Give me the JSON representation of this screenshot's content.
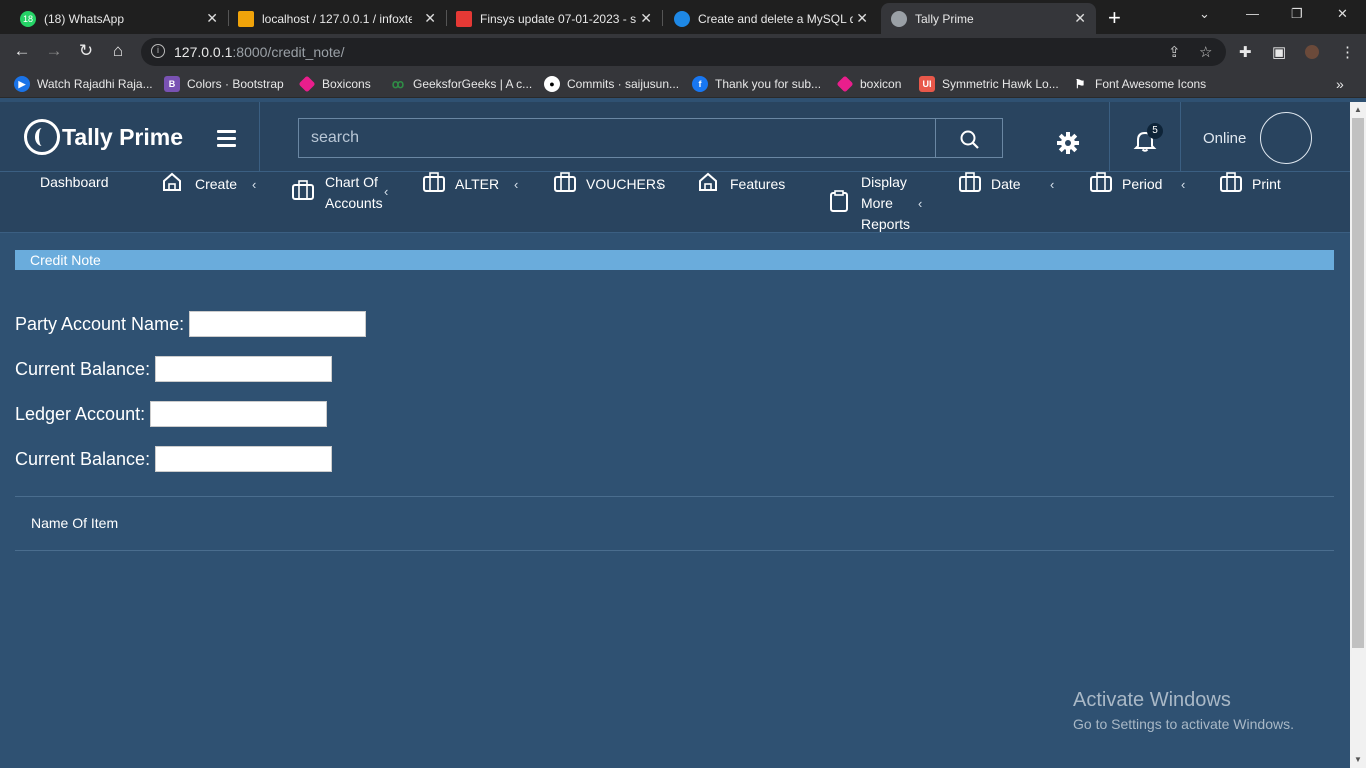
{
  "browser": {
    "tabs": [
      {
        "title": "(18) WhatsApp",
        "badge": "18",
        "color": "#25d366"
      },
      {
        "title": "localhost / 127.0.0.1 / infoxte",
        "badge": "",
        "color": "#f0a30a"
      },
      {
        "title": "Finsys update 07-01-2023 - s",
        "badge": "",
        "color": "#e53935"
      },
      {
        "title": "Create and delete a MySQL d",
        "badge": "",
        "color": "#1e88e5"
      },
      {
        "title": "Tally Prime",
        "badge": "",
        "color": "#9aa0a6"
      }
    ],
    "url_host": "127.0.0.1",
    "url_path": ":8000/credit_note/",
    "bookmarks": [
      {
        "label": "Watch Rajadhi Raja...",
        "color": "#1a73e8",
        "icon": "▶"
      },
      {
        "label": "Colors · Bootstrap",
        "color": "#7952b3",
        "icon": "B"
      },
      {
        "label": "Boxicons",
        "color": "#e91e8c",
        "icon": "◆"
      },
      {
        "label": "GeeksforGeeks | A c...",
        "color": "#2f8d46",
        "icon": "ꝏ"
      },
      {
        "label": "Commits · saijusun...",
        "color": "#333333",
        "icon": "●"
      },
      {
        "label": "Thank you for sub...",
        "color": "#1877f2",
        "icon": "f"
      },
      {
        "label": "boxicon",
        "color": "#e91e8c",
        "icon": "◆"
      },
      {
        "label": "Symmetric Hawk Lo...",
        "color": "#e8584a",
        "icon": "UI"
      },
      {
        "label": "Font Awesome Icons",
        "color": "#444444",
        "icon": "⚑"
      }
    ]
  },
  "app": {
    "brand": "Tally Prime",
    "search_placeholder": "search",
    "notification_count": "5",
    "status": "Online",
    "menu": {
      "dashboard": "Dashboard",
      "create": "Create",
      "chart_l1": "Chart Of",
      "chart_l2": "Accounts",
      "alter": "ALTER",
      "vouchers": "VOUCHERS",
      "features": "Features",
      "display_l1": "Display",
      "display_l2": "More",
      "display_l3": "Reports",
      "date": "Date",
      "period": "Period",
      "print": "Print"
    },
    "page_title": "Credit Note",
    "form": {
      "party_account_name": "Party Account Name:",
      "current_balance_1": "Current Balance:",
      "ledger_account": "Ledger Account:",
      "current_balance_2": "Current Balance:"
    },
    "table_header": "Name Of Item"
  },
  "overlay": {
    "line1": "Activate Windows",
    "line2": "Go to Settings to activate Windows."
  },
  "colors": {
    "page_bg": "#2f5172",
    "header_bg": "#29445f",
    "title_strip": "#6aacdc"
  }
}
